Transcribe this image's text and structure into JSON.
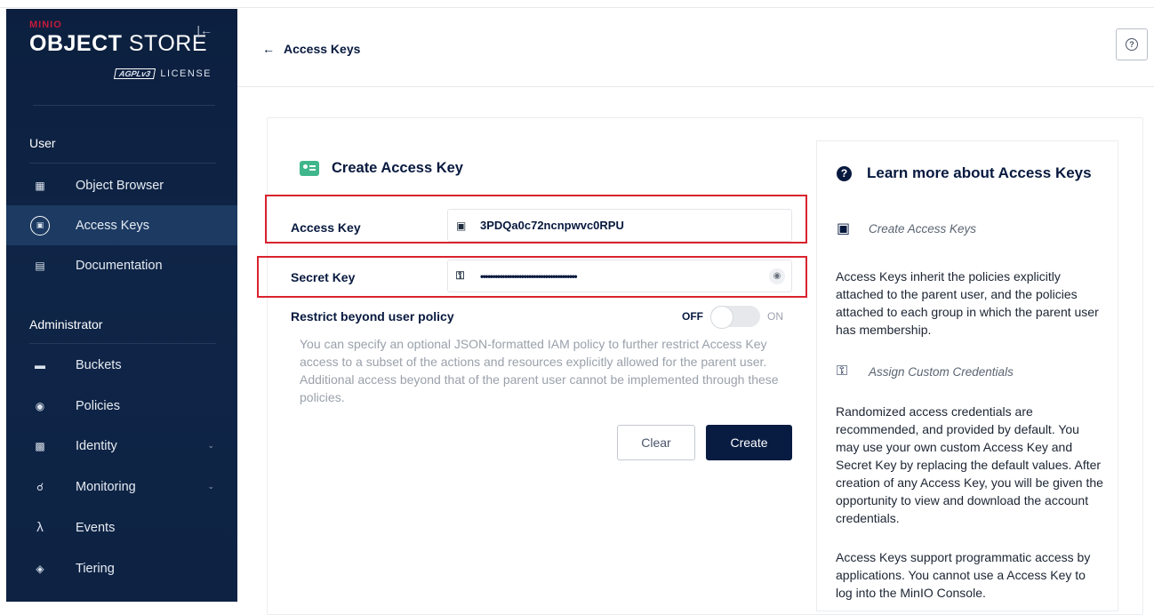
{
  "brand": {
    "minio": "MINIO",
    "store_bold": "OBJECT",
    "store_light": " STORE",
    "license_badge": "AGPLv3",
    "license_text": "LICENSE"
  },
  "sidebar": {
    "user_section": "User",
    "admin_section": "Administrator",
    "user_items": [
      {
        "label": "Object Browser",
        "icon": "object-browser-icon"
      },
      {
        "label": "Access Keys",
        "icon": "access-keys-icon",
        "active": true
      },
      {
        "label": "Documentation",
        "icon": "documentation-icon"
      }
    ],
    "admin_items": [
      {
        "label": "Buckets",
        "icon": "buckets-icon"
      },
      {
        "label": "Policies",
        "icon": "policies-icon"
      },
      {
        "label": "Identity",
        "icon": "identity-icon",
        "expandable": true
      },
      {
        "label": "Monitoring",
        "icon": "monitoring-icon",
        "expandable": true
      },
      {
        "label": "Events",
        "icon": "lambda-icon"
      },
      {
        "label": "Tiering",
        "icon": "tiering-icon"
      }
    ]
  },
  "header": {
    "back_label": "Access Keys"
  },
  "form": {
    "title": "Create Access Key",
    "access_key_label": "Access Key",
    "access_key_value": "3PDQa0c72ncnpwvc0RPU",
    "secret_key_label": "Secret Key",
    "secret_key_masked": "••••••••••••••••••••••••••••••••••••••••",
    "restrict_label": "Restrict beyond user policy",
    "toggle_off": "OFF",
    "toggle_on": "ON",
    "restrict_description": "You can specify an optional JSON-formatted IAM policy to further restrict Access Key access to a subset of the actions and resources explicitly allowed for the parent user. Additional access beyond that of the parent user cannot be implemented through these policies.",
    "clear_button": "Clear",
    "create_button": "Create"
  },
  "help": {
    "title": "Learn more about Access Keys",
    "sub1": "Create Access Keys",
    "para1": "Access Keys inherit the policies explicitly attached to the parent user, and the policies attached to each group in which the parent user has membership.",
    "sub2": "Assign Custom Credentials",
    "para2": "Randomized access credentials are recommended, and provided by default. You may use your own custom Access Key and Secret Key by replacing the default values. After creation of any Access Key, you will be given the opportunity to view and download the account credentials.",
    "para3": "Access Keys support programmatic access by applications. You cannot use a Access Key to log into the MinIO Console."
  },
  "colors": {
    "sidebar_bg": "#0f2547",
    "accent_green": "#3fb68b",
    "primary_button": "#081c42",
    "highlight_red": "#d9232e"
  }
}
